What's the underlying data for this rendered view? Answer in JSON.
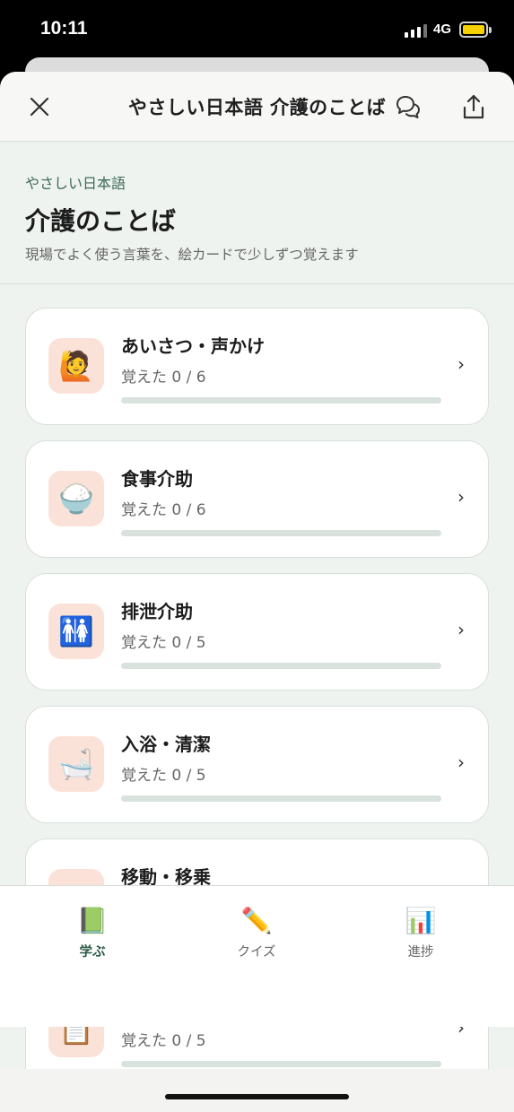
{
  "status_bar": {
    "time": "10:11",
    "network": "4G"
  },
  "nav": {
    "title": "やさしい日本語 介護のことば"
  },
  "header": {
    "eyebrow": "やさしい日本語",
    "title": "介護のことば",
    "subtitle": "現場でよく使う言葉を、絵カードで少しずつ覚えます"
  },
  "categories": [
    {
      "title": "あいさつ・声かけ",
      "progress_text": "覚えた 0 / 6",
      "learned": 0,
      "total": 6,
      "icon": "🙋",
      "icon_name": "person-raising-hand-icon"
    },
    {
      "title": "食事介助",
      "progress_text": "覚えた 0 / 6",
      "learned": 0,
      "total": 6,
      "icon": "🍚",
      "icon_name": "rice-bowl-icon"
    },
    {
      "title": "排泄介助",
      "progress_text": "覚えた 0 / 5",
      "learned": 0,
      "total": 5,
      "icon": "🚻",
      "icon_name": "restroom-icon"
    },
    {
      "title": "入浴・清潔",
      "progress_text": "覚えた 0 / 5",
      "learned": 0,
      "total": 5,
      "icon": "🛁",
      "icon_name": "bathtub-icon"
    },
    {
      "title": "移動・移乗",
      "progress_text": "",
      "learned": 0,
      "total": null,
      "icon": "",
      "icon_name": "transfer-icon"
    },
    {
      "title": "",
      "progress_text": "覚えた 0 / 5",
      "learned": 0,
      "total": 5,
      "icon": "📋",
      "icon_name": "clipboard-icon"
    }
  ],
  "tabs": [
    {
      "label": "学ぶ",
      "icon": "📗",
      "icon_name": "green-book-icon",
      "active": true
    },
    {
      "label": "クイズ",
      "icon": "✏️",
      "icon_name": "pencil-icon",
      "active": false
    },
    {
      "label": "進捗",
      "icon": "📊",
      "icon_name": "bar-chart-icon",
      "active": false
    }
  ],
  "colors": {
    "accent": "#3d6b58",
    "background": "#eef3ef",
    "icon_box": "#fbe2d8",
    "battery": "#f6d000"
  }
}
